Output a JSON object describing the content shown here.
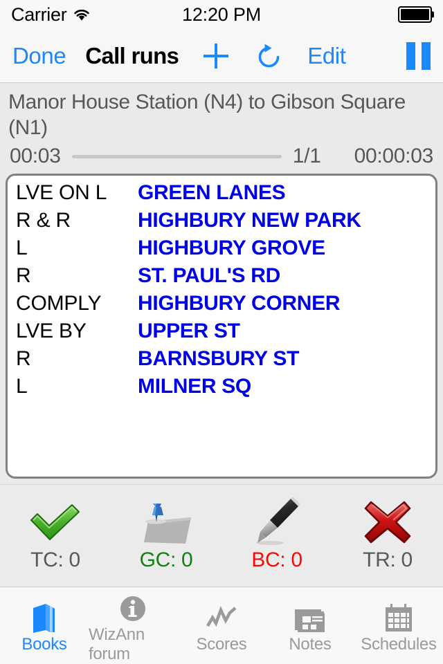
{
  "status_bar": {
    "carrier": "Carrier",
    "wifi_icon": "wifi-icon",
    "time": "12:20 PM",
    "battery_icon": "battery-full-icon"
  },
  "nav_bar": {
    "done_label": "Done",
    "title": "Call runs",
    "add_icon": "plus-icon",
    "refresh_icon": "refresh-clockwise-icon",
    "edit_label": "Edit",
    "pause_icon": "pause-icon",
    "tint_color": "#1b88fb"
  },
  "route": {
    "title": "Manor House Station (N4) to Gibson Square (N1)",
    "elapsed": "00:03",
    "page_indicator": "1/1",
    "total_time": "00:00:03",
    "progress_percent": 100
  },
  "call_list": {
    "rows": [
      {
        "instruction": "LVE ON L",
        "street": "GREEN LANES"
      },
      {
        "instruction": "R & R",
        "street": "HIGHBURY NEW PARK"
      },
      {
        "instruction": "L",
        "street": "HIGHBURY GROVE"
      },
      {
        "instruction": "R",
        "street": "ST. PAUL'S RD"
      },
      {
        "instruction": "COMPLY",
        "street": "HIGHBURY CORNER"
      },
      {
        "instruction": "LVE BY",
        "street": "UPPER ST"
      },
      {
        "instruction": "R",
        "street": "BARNSBURY ST"
      },
      {
        "instruction": "L",
        "street": "MILNER SQ"
      }
    ],
    "street_color": "#0000e6",
    "instruction_color": "#000000"
  },
  "counters": [
    {
      "icon": "green-check-icon",
      "label": "TC: 0",
      "color": "#585858"
    },
    {
      "icon": "pushpin-paper-icon",
      "label": "GC: 0",
      "color": "#128012"
    },
    {
      "icon": "pen-icon",
      "label": "BC: 0",
      "color": "#fa0808"
    },
    {
      "icon": "red-cross-icon",
      "label": "TR: 0",
      "color": "#585858"
    }
  ],
  "tab_bar": {
    "items": [
      {
        "label": "Books",
        "icon": "books-icon",
        "active": true
      },
      {
        "label": "WizAnn forum",
        "icon": "info-icon",
        "active": false
      },
      {
        "label": "Scores",
        "icon": "chart-line-icon",
        "active": false
      },
      {
        "label": "Notes",
        "icon": "notes-icon",
        "active": false
      },
      {
        "label": "Schedules",
        "icon": "calendar-icon",
        "active": false
      }
    ],
    "active_color": "#1b88fb",
    "inactive_color": "#9a9a9a"
  }
}
